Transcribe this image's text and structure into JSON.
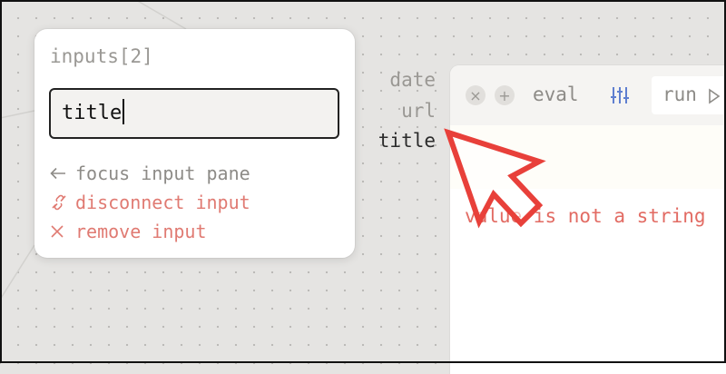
{
  "popup": {
    "title": "inputs[2]",
    "field_value": "title",
    "menu": [
      {
        "label": "focus input pane",
        "icon": "arrow-left-icon"
      },
      {
        "label": "disconnect input",
        "icon": "unlink-icon"
      },
      {
        "label": "remove input",
        "icon": "close-icon"
      }
    ]
  },
  "input_labels": [
    "date",
    "url",
    "title"
  ],
  "node": {
    "toolbar": {
      "eval_label": "eval",
      "run_label": "run"
    },
    "error_message": "value is not a string"
  },
  "colors": {
    "error": "#e26b63",
    "danger_menu": "#e07a72",
    "cursor": "#e8403a"
  }
}
